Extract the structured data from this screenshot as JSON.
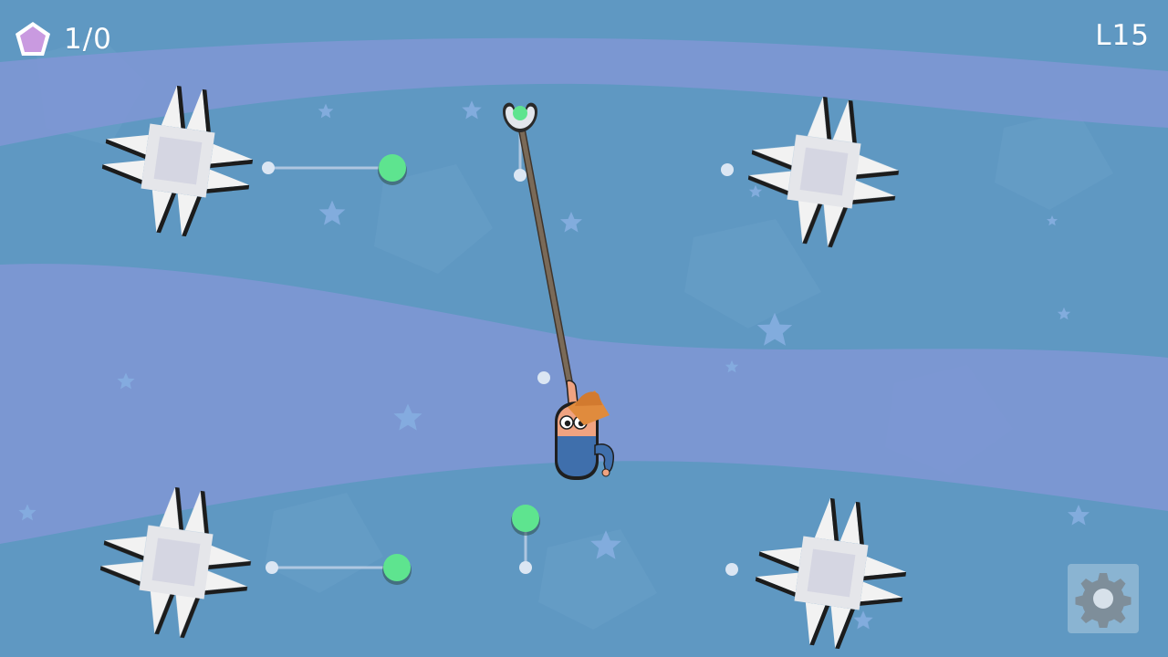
{
  "hud": {
    "gems_counter": "1/0",
    "level": "L15"
  },
  "icons": {
    "gem": "pentagon-gem-icon",
    "settings": "gear-icon"
  },
  "colors": {
    "sky": "#5f98c2",
    "wave_band": "#7e97d4",
    "gem": "#c99ae0",
    "anchor_active": "#5ee48f",
    "rope": "#6a5a49",
    "hat": "#e08b3d",
    "skin": "#f0a381",
    "body": "#3f6fac",
    "spike_light": "#f2f2f2",
    "spike_dark": "#1c1c1c"
  },
  "scene": {
    "spike_blocks": 4,
    "active_anchors": 4,
    "inactive_anchors": 6
  }
}
